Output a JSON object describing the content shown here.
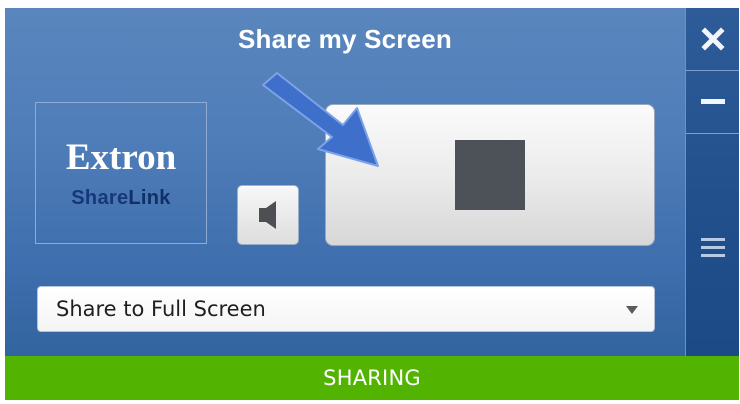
{
  "window": {
    "title": "Share my Screen",
    "logo": {
      "main": "Extron",
      "sub_prefix": "Share",
      "sub_suffix": "Link"
    },
    "speaker_button": {
      "icon": "speaker-icon"
    },
    "share_button": {
      "icon": "stop-icon",
      "annotation_icon": "arrow-icon"
    },
    "dropdown": {
      "selected": "Share to Full Screen",
      "icon": "chevron-down-icon"
    },
    "side_controls": {
      "close_icon": "close-icon",
      "minimize_icon": "minimize-icon",
      "menu_icon": "menu-icon"
    },
    "status": {
      "text": "SHARING"
    },
    "colors": {
      "panel": "#4f7db8",
      "rail": "#22508d",
      "status": "#52b400",
      "logo_sub": "#16387a",
      "annotation_arrow": "#3d6fcb",
      "stop": "#4d5259"
    }
  }
}
